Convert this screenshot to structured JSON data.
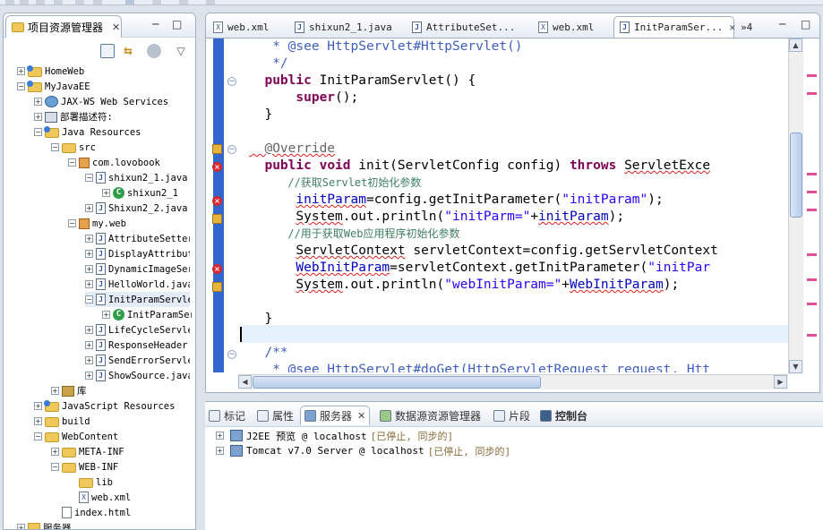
{
  "left_panel": {
    "title": "项目资源管理器",
    "close": "✕",
    "minimize": "─",
    "maximize": "□",
    "view_menu": "▽",
    "tree": [
      {
        "label": "HomeWeb",
        "icon": "project-icon",
        "expander": "+"
      },
      {
        "label": "MyJavaEE",
        "icon": "project-icon",
        "expander": "−"
      },
      {
        "label": "JAX-WS Web Services",
        "icon": "web-services-icon",
        "expander": "+"
      },
      {
        "label": "部署描述符:",
        "icon": "deployment-descriptor-icon",
        "expander": "+"
      },
      {
        "label": "Java Resources",
        "icon": "java-resources-icon",
        "expander": "−"
      },
      {
        "label": "src",
        "icon": "source-folder-icon",
        "expander": "−"
      },
      {
        "label": "com.lovobook",
        "icon": "package-icon",
        "expander": "−"
      },
      {
        "label": "shixun2_1.java",
        "icon": "java-file-icon",
        "expander": "−"
      },
      {
        "label": "shixun2_1",
        "icon": "class-icon",
        "expander": "+"
      },
      {
        "label": "Shixun2_2.java",
        "icon": "java-file-icon",
        "expander": "+"
      },
      {
        "label": "my.web",
        "icon": "package-icon",
        "expander": "−"
      },
      {
        "label": "AttributeSetter",
        "icon": "java-file-icon",
        "expander": "+"
      },
      {
        "label": "DisplayAttribute",
        "icon": "java-file-icon",
        "expander": "+"
      },
      {
        "label": "DynamicImageServlet",
        "icon": "java-file-icon",
        "expander": "+"
      },
      {
        "label": "HelloWorld.java",
        "icon": "java-file-icon",
        "expander": "+"
      },
      {
        "label": "InitParamServlet",
        "icon": "java-file-icon",
        "expander": "−"
      },
      {
        "label": "InitParamServlet",
        "icon": "class-icon",
        "expander": "+"
      },
      {
        "label": "LifeCycleServlet",
        "icon": "java-file-icon",
        "expander": "+"
      },
      {
        "label": "ResponseHeader",
        "icon": "java-file-icon",
        "expander": "+"
      },
      {
        "label": "SendErrorServlet",
        "icon": "java-file-icon",
        "expander": "+"
      },
      {
        "label": "ShowSource.java",
        "icon": "java-file-icon",
        "expander": "+"
      },
      {
        "label": "库",
        "icon": "library-icon",
        "expander": "+"
      },
      {
        "label": "JavaScript Resources",
        "icon": "javascript-resources-icon",
        "expander": "+"
      },
      {
        "label": "build",
        "icon": "folder-icon",
        "expander": "+"
      },
      {
        "label": "WebContent",
        "icon": "folder-icon",
        "expander": "−"
      },
      {
        "label": "META-INF",
        "icon": "folder-icon",
        "expander": "+"
      },
      {
        "label": "WEB-INF",
        "icon": "folder-icon",
        "expander": "−"
      },
      {
        "label": "lib",
        "icon": "folder-icon",
        "expander": ""
      },
      {
        "label": "web.xml",
        "icon": "xml-file-icon",
        "expander": ""
      },
      {
        "label": "index.html",
        "icon": "html-file-icon",
        "expander": ""
      },
      {
        "label": "服务器",
        "icon": "servers-folder-icon",
        "expander": "+"
      }
    ]
  },
  "editor": {
    "tabs": [
      {
        "label": "web.xml",
        "icon": "xml-file-icon"
      },
      {
        "label": "shixun2_1.java",
        "icon": "java-file-icon"
      },
      {
        "label": "AttributeSet...",
        "icon": "java-file-icon"
      },
      {
        "label": "web.xml",
        "icon": "xml-file-icon"
      },
      {
        "label": "InitParamSer...",
        "icon": "java-file-icon"
      }
    ],
    "overflow_label": "»4",
    "tab_close": "✕",
    "code": [
      "   * @see HttpServlet#HttpServlet()",
      "   */",
      "  public InitParamServlet() {",
      "      super();",
      "  }",
      "",
      "  @Override",
      "  public void init(ServletConfig config) throws ServletExce",
      "      //获取Servlet初始化参数",
      "      initParam=config.getInitParameter(\"initParam\");",
      "      System.out.println(\"initParm=\"+initParam);",
      "      //用于获取Web应用程序初始化参数",
      "      ServletContext servletContext=config.getServletContext",
      "      WebInitParam=servletContext.getInitParameter(\"initPar",
      "      System.out.println(\"webInitParam=\"+WebInitParam);",
      "",
      "  }",
      "",
      "  /**",
      "   * @see HttpServlet#doGet(HttpServletRequest request, Htt"
    ]
  },
  "bottom_panel": {
    "tabs": [
      "标记",
      "属性",
      "服务器",
      "数据源资源管理器",
      "片段",
      "控制台"
    ],
    "tab_close": "✕",
    "servers": [
      {
        "name": "J2EE 预览 @ localhost",
        "status": "[已停止, 同步的]"
      },
      {
        "name": "Tomcat v7.0 Server @ localhost",
        "status": "[已停止, 同步的]"
      }
    ]
  }
}
